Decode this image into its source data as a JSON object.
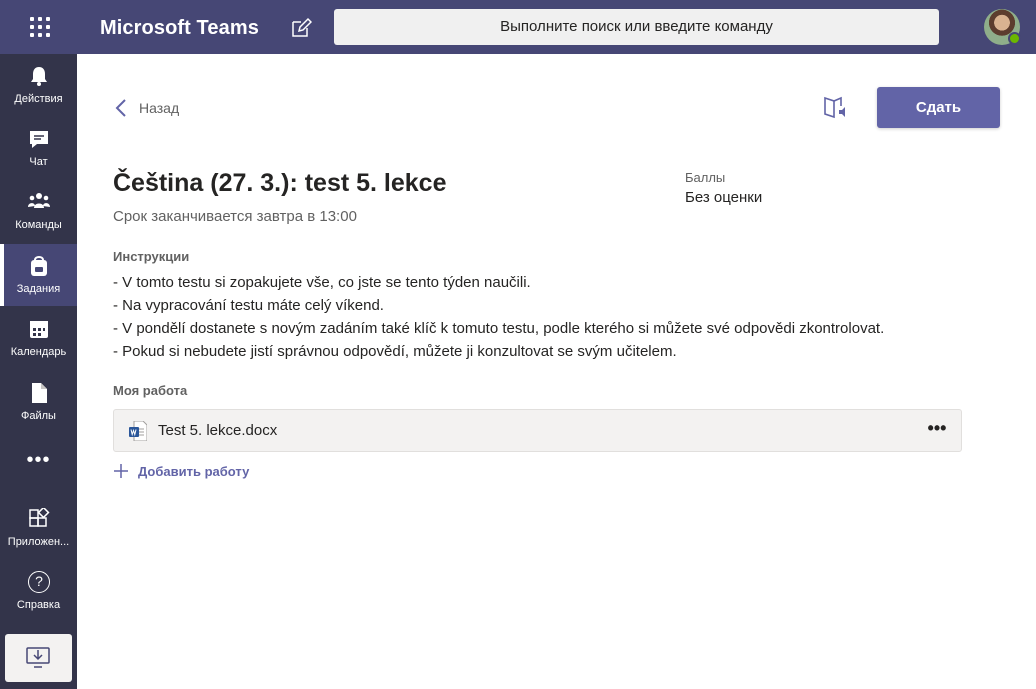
{
  "topbar": {
    "app_title": "Microsoft Teams",
    "search_placeholder": "Выполните поиск или введите команду",
    "accent_color": "#464775"
  },
  "rail": {
    "items": [
      {
        "label": "Действия",
        "icon": "bell-icon"
      },
      {
        "label": "Чат",
        "icon": "chat-icon"
      },
      {
        "label": "Команды",
        "icon": "teams-icon"
      },
      {
        "label": "Задания",
        "icon": "backpack-icon",
        "active": true
      },
      {
        "label": "Календарь",
        "icon": "calendar-icon"
      },
      {
        "label": "Файлы",
        "icon": "file-icon"
      }
    ],
    "more": "•••",
    "apps_label": "Приложен...",
    "help_label": "Справка",
    "help_glyph": "?"
  },
  "assignment": {
    "back_label": "Назад",
    "submit_label": "Сдать",
    "title": "Čeština (27. 3.): test 5. lekce",
    "due": "Срок заканчивается завтра в 13:00",
    "points_label": "Баллы",
    "points_value": "Без оценки",
    "instructions_label": "Инструкции",
    "instructions": [
      "- V tomto testu si zopakujete vše, co jste se tento týden naučili.",
      "- Na vypracování testu máte celý víkend.",
      "- V pondělí dostanete s novým zadáním také klíč k tomuto testu, podle kterého si můžete své odpovědi zkontrolovat.",
      "- Pokud si nebudete jistí správnou odpovědí, můžete ji konzultovat se svým učitelem."
    ],
    "my_work_label": "Моя работа",
    "file_name": "Test 5. lekce.docx",
    "file_more": "•••",
    "add_work_label": "Добавить работу",
    "button_color": "#6264a7"
  }
}
